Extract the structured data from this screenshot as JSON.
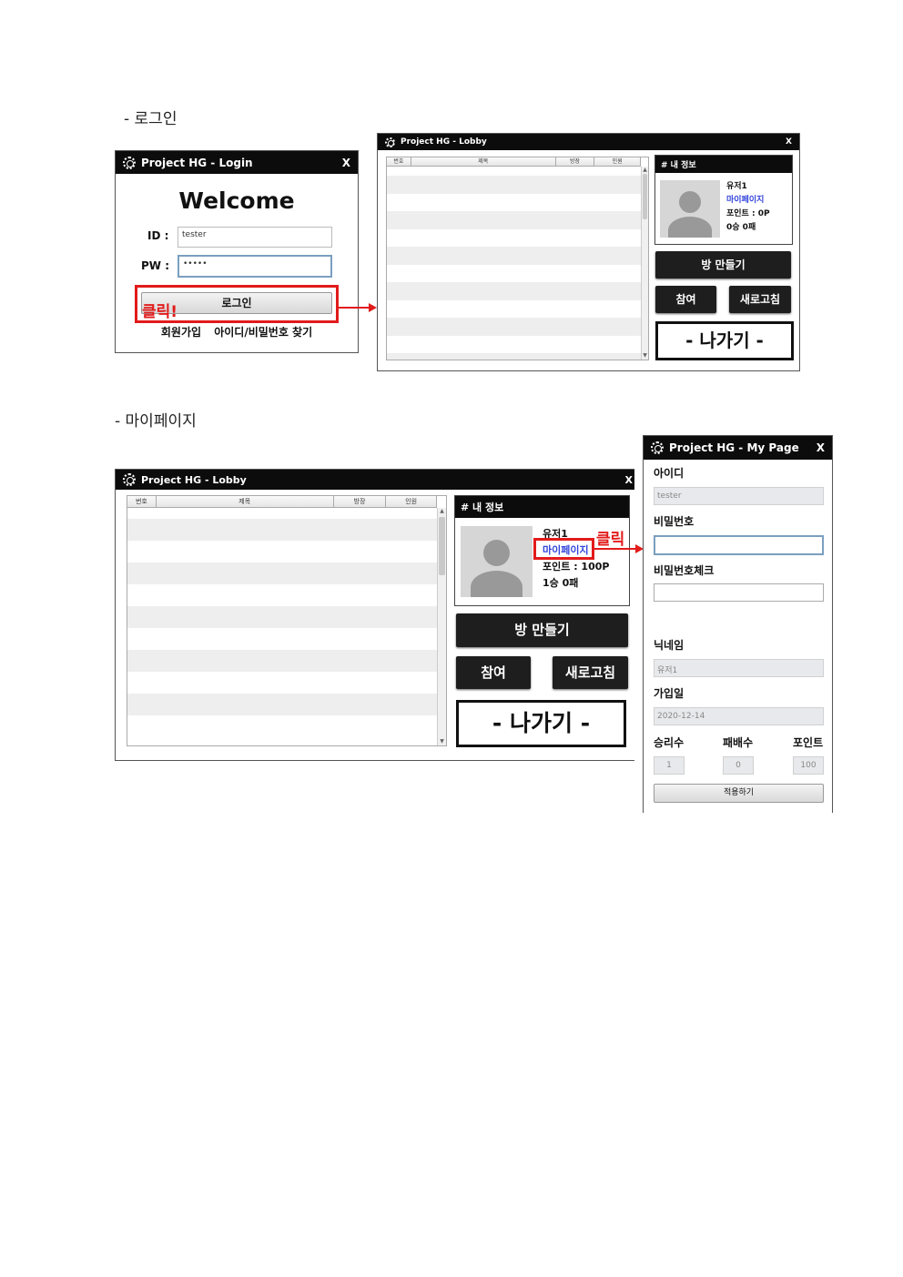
{
  "sections": {
    "login_heading": "-  로그인",
    "mypage_heading": "-  마이페이지"
  },
  "login": {
    "title": "Project HG - Login",
    "close": "X",
    "welcome": "Welcome",
    "id_label": "ID :",
    "id_value": "tester",
    "pw_label": "PW :",
    "pw_value": "•••••",
    "login_button": "로그인",
    "signup_link": "회원가입",
    "find_link": "아이디/비밀번호 찾기",
    "callout": "클릭!"
  },
  "lobby": {
    "title": "Project HG - Lobby",
    "close": "X",
    "columns": [
      "번호",
      "제목",
      "방장",
      "인원"
    ],
    "info_header": "# 내 정보",
    "username": "유저1",
    "mypage_link": "마이페이지",
    "create_room": "방 만들기",
    "join": "참여",
    "refresh": "새로고침",
    "exit": "- 나가기 -"
  },
  "lobby1": {
    "points": "포인트 : 0P",
    "record": "0승 0패"
  },
  "lobby2": {
    "points": "포인트 : 100P",
    "record": "1승 0패",
    "callout": "클릭"
  },
  "mypage": {
    "title": "Project HG - My Page",
    "close": "X",
    "id_label": "아이디",
    "id_value": "tester",
    "pw_label": "비밀번호",
    "pw_check_label": "비밀번호체크",
    "nick_label": "닉네임",
    "nick_value": "유저1",
    "join_label": "가입일",
    "join_value": "2020-12-14",
    "wins_label": "승리수",
    "losses_label": "패배수",
    "points_label": "포인트",
    "wins_value": "1",
    "losses_value": "0",
    "points_value": "100",
    "apply_button": "적용하기"
  },
  "colors": {
    "titlebar": "#0c0c0c",
    "callout": "#e21b1b",
    "link": "#3344dd"
  }
}
